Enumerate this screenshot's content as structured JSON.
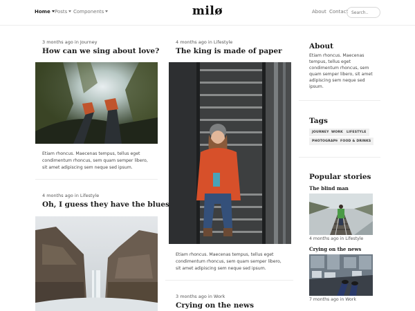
{
  "nav": {
    "home": "Home",
    "posts": "Posts",
    "components": "Components",
    "brand": "milø",
    "about": "About",
    "contact": "Contact",
    "search_placeholder": "Search.."
  },
  "posts": [
    {
      "meta": "3 months ago in Journey",
      "title": "How can we sing about love?",
      "excerpt": "Etiam rhoncus. Maecenas tempus, tellus eget condimentum rhoncus, sem quam semper libero, sit amet adipiscing sem neque sed ipsum."
    },
    {
      "meta": "4 months ago in Lifestyle",
      "title": "Oh, I guess they have the blues"
    },
    {
      "meta": "4 months ago in Lifestyle",
      "title": "The king is made of paper",
      "excerpt": "Etiam rhoncus. Maecenas tempus, tellus eget condimentum rhoncus, sem quam semper libero, sit amet adipiscing sem neque sed ipsum."
    },
    {
      "meta": "3 months ago in Work",
      "title": "Crying on the news"
    }
  ],
  "sidebar": {
    "about_heading": "About",
    "about_text": "Etiam rhoncus. Maecenas tempus, tellus eget condimentum rhoncus, sem quam semper libero, sit amet adipiscing sem neque sed ipsum.",
    "tags_heading": "Tags",
    "tags": [
      "JOURNEY",
      "WORK",
      "LIFESTYLE",
      "PHOTOGRAPHY",
      "FOOD & DRINKS"
    ],
    "popular_heading": "Popular stories",
    "stories": [
      {
        "title": "The blind man",
        "meta": "4 months ago in Lifestyle"
      },
      {
        "title": "Crying on the news",
        "meta": "7 months ago in Work"
      }
    ]
  }
}
